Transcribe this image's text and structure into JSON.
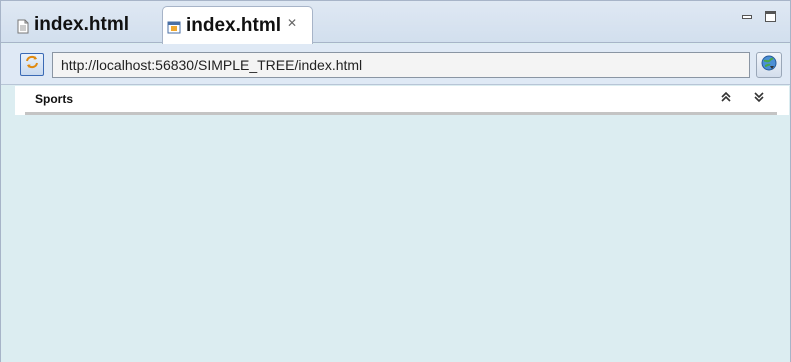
{
  "tabs": [
    {
      "label": "index.html",
      "active": false,
      "icon": "html-file-icon"
    },
    {
      "label": "index.html",
      "active": true,
      "icon": "browser-page-icon",
      "close_icon": "close-icon"
    }
  ],
  "toolbar": {
    "url": "http://localhost:56830/SIMPLE_TREE/index.html",
    "refresh_icon": "refresh-icon",
    "go_icon": "globe-go-icon"
  },
  "page": {
    "header_title": "Sports",
    "collapse_icon": "collapse-all-icon",
    "expand_icon": "expand-all-icon"
  },
  "colors": {
    "tabbar_bg": "#d2dfee",
    "content_bg": "#dcedf1",
    "border": "#a7b4c8"
  }
}
